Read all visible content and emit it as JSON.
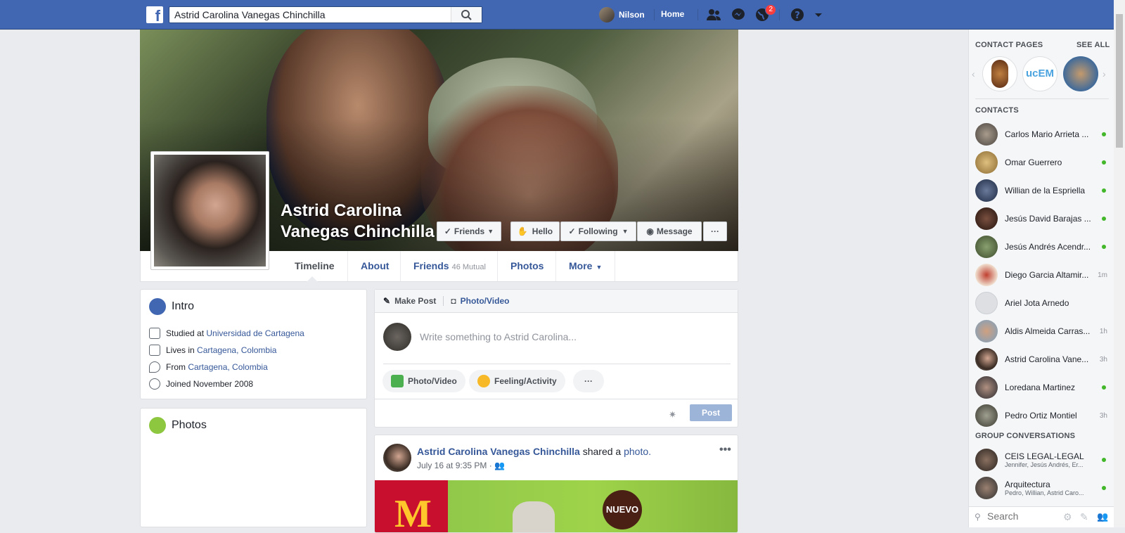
{
  "topbar": {
    "logo": "f",
    "search_value": "Astrid Carolina Vanegas Chinchilla",
    "user_name": "Nilson",
    "home_label": "Home",
    "notification_count": "2",
    "brand_color": "#4267b2"
  },
  "profile": {
    "name_line1": "Astrid Carolina",
    "name_line2": "Vanegas Chinchilla",
    "buttons": {
      "friends": "Friends",
      "hello": "Hello",
      "following": "Following",
      "message": "Message",
      "more": "···"
    },
    "tabs": {
      "timeline": "Timeline",
      "about": "About",
      "friends": "Friends",
      "friends_mutual": "46 Mutual",
      "photos": "Photos",
      "more": "More"
    }
  },
  "intro": {
    "title": "Intro",
    "studied_prefix": "Studied at",
    "studied_link": "Universidad de Cartagena",
    "lives_prefix": "Lives in",
    "lives_link": "Cartagena, Colombia",
    "from_prefix": "From",
    "from_link": "Cartagena, Colombia",
    "joined": "Joined November 2008"
  },
  "photos_card": {
    "title": "Photos"
  },
  "composer": {
    "make_post": "Make Post",
    "photo_video_tab": "Photo/Video",
    "placeholder": "Write something to Astrid Carolina...",
    "photo_video": "Photo/Video",
    "feeling": "Feeling/Activity",
    "more": "···",
    "post_button": "Post"
  },
  "post": {
    "author": "Astrid Carolina Vanegas Chinchilla",
    "action": "shared a",
    "action_link": "photo.",
    "timestamp": "July 16 at 9:35 PM ·",
    "image_text_nuevo": "NUEVO",
    "image_logo": "M"
  },
  "sidebar": {
    "contact_pages_heading": "CONTACT PAGES",
    "see_all": "SEE ALL",
    "page_ucem": "ucEM",
    "contacts_heading": "CONTACTS",
    "contacts": [
      {
        "name": "Carlos Mario Arrieta ...",
        "status": "online"
      },
      {
        "name": "Omar Guerrero",
        "status": "online"
      },
      {
        "name": "Willian de la Espriella",
        "status": "online"
      },
      {
        "name": "Jesús David Barajas ...",
        "status": "online"
      },
      {
        "name": "Jesús Andrés Acendr...",
        "status": "online"
      },
      {
        "name": "Diego Garcia Altamir...",
        "status": "1m"
      },
      {
        "name": "Ariel Jota Arnedo",
        "status": ""
      },
      {
        "name": "Aldis Almeida Carras...",
        "status": "1h"
      },
      {
        "name": "Astrid Carolina Vane...",
        "status": "3h"
      },
      {
        "name": "Loredana Martinez",
        "status": "online"
      },
      {
        "name": "Pedro Ortiz Montiel",
        "status": "3h"
      }
    ],
    "group_heading": "GROUP CONVERSATIONS",
    "groups": [
      {
        "name": "CEIS LEGAL-LEGAL",
        "members": "Jennifer, Jesús Andrés, Er..."
      },
      {
        "name": "Arquitectura",
        "members": "Pedro, Willian, Astrid Caro..."
      }
    ],
    "search_placeholder": "Search"
  }
}
